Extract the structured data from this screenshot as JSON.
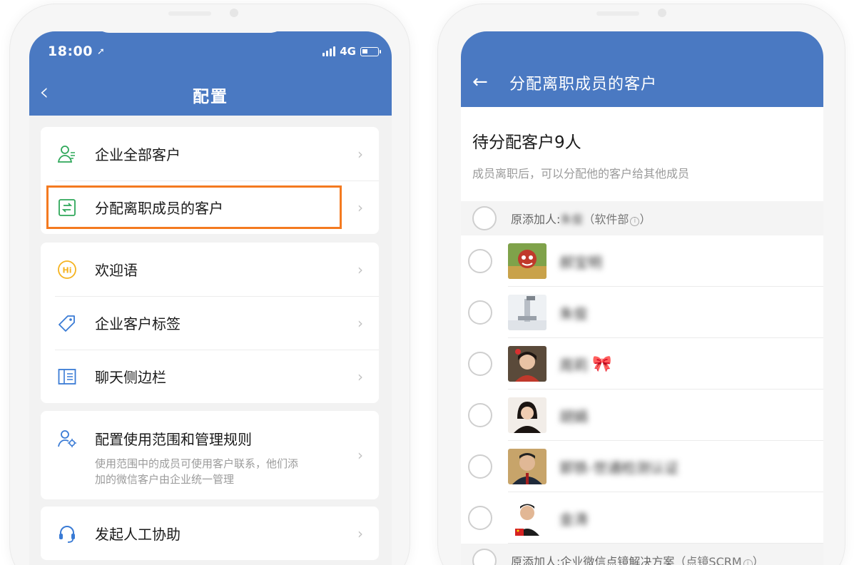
{
  "left_phone": {
    "status_bar": {
      "time": "18:00",
      "location_arrow": "➚",
      "network": "4G"
    },
    "header": {
      "title": "配置",
      "back_glyph": "‹"
    },
    "groups": [
      {
        "items": [
          {
            "icon": "customer-person-icon",
            "label": "企业全部客户"
          },
          {
            "icon": "transfer-icon",
            "label": "分配离职成员的客户",
            "highlighted": true
          }
        ]
      },
      {
        "items": [
          {
            "icon": "hi-greeting-icon",
            "label": "欢迎语"
          },
          {
            "icon": "tag-icon",
            "label": "企业客户标签"
          },
          {
            "icon": "sidebar-icon",
            "label": "聊天侧边栏"
          }
        ]
      },
      {
        "items": [
          {
            "icon": "person-gear-icon",
            "label": "配置使用范围和管理规则",
            "desc_line1": "使用范围中的成员可使用客户联系，他们添",
            "desc_line2": "加的微信客户由企业统一管理"
          }
        ]
      },
      {
        "items": [
          {
            "icon": "headset-icon",
            "label": "发起人工协助"
          }
        ]
      }
    ],
    "chevron": "›",
    "highlight_color": "#f47a20"
  },
  "right_phone": {
    "header": {
      "back_glyph": "←",
      "title": "分配离职成员的客户"
    },
    "pending": {
      "count_label": "待分配客户9人",
      "hint": "成员离职后，可以分配他的客户给其他成员"
    },
    "section_1": {
      "prefix": "原添加人:",
      "name": "朱俊",
      "dept": "（软件部",
      "dept_close": "）"
    },
    "customers": [
      {
        "name": "郝宝明",
        "avatar": "avatar-1"
      },
      {
        "name": "朱俊",
        "avatar": "avatar-2"
      },
      {
        "name": "周莉",
        "avatar": "avatar-3",
        "emoji": "🎀"
      },
      {
        "name": "胡娟",
        "avatar": "avatar-4"
      },
      {
        "name": "郭铁-世通检测认证",
        "avatar": "avatar-5"
      },
      {
        "name": "金涛",
        "avatar": "avatar-6"
      }
    ],
    "section_2": {
      "prefix": "原添加人:",
      "name": "企业微信点镜解决方案",
      "dept": "（点镜SCRM",
      "dept_close": "）"
    },
    "info_glyph": "i"
  },
  "colors": {
    "header_blue": "#4a79c2",
    "accent_orange": "#f47a20",
    "icon_green": "#2fa85a",
    "icon_blue": "#3a7bd5",
    "icon_yellow": "#f5b320"
  }
}
